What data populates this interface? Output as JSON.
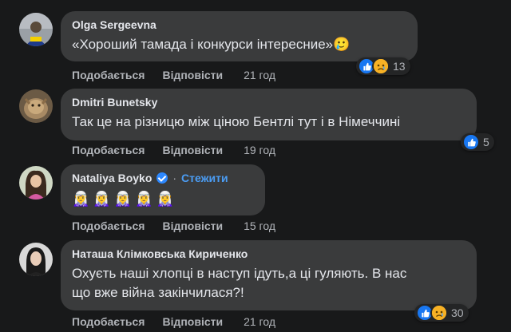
{
  "colors": {
    "background": "#18191a",
    "bubble": "#3a3b3c",
    "like_blue": "#1877f2",
    "link_blue": "#4b9df5",
    "sad_yellow": "#f7b125",
    "muted_text": "#b0b3b8"
  },
  "comments": [
    {
      "author": "Olga Sergeevna",
      "text": "«Хороший тамада і конкурси інтересние»🥲",
      "like_label": "Подобається",
      "reply_label": "Відповісти",
      "time": "21 год",
      "reactions": [
        "like-icon",
        "sad-icon"
      ],
      "reaction_count": "13"
    },
    {
      "author": "Dmitri Bunetsky",
      "text": "Так це на різницю між ціною Бентлі тут і в Німеччині",
      "like_label": "Подобається",
      "reply_label": "Відповісти",
      "time": "19 год",
      "reactions": [
        "like-icon"
      ],
      "reaction_count": "5"
    },
    {
      "author": "Nataliya Boyko",
      "follow_label": "Стежити",
      "separator": "·",
      "emojis": [
        "🧝‍♀️",
        "🧝‍♀️",
        "🧝‍♀️",
        "🧝‍♀️",
        "🧝‍♀️"
      ],
      "like_label": "Подобається",
      "reply_label": "Відповісти",
      "time": "15 год"
    },
    {
      "author": "Наташа Клімковська Кириченко",
      "text_line1": "Охуєть наші хлопці в наступ ідуть,а ці гуляють. В нас",
      "text_line2": "що вже війна закінчилася?!",
      "like_label": "Подобається",
      "reply_label": "Відповісти",
      "time": "21 год",
      "reactions": [
        "like-icon",
        "sad-icon"
      ],
      "reaction_count": "30"
    }
  ]
}
